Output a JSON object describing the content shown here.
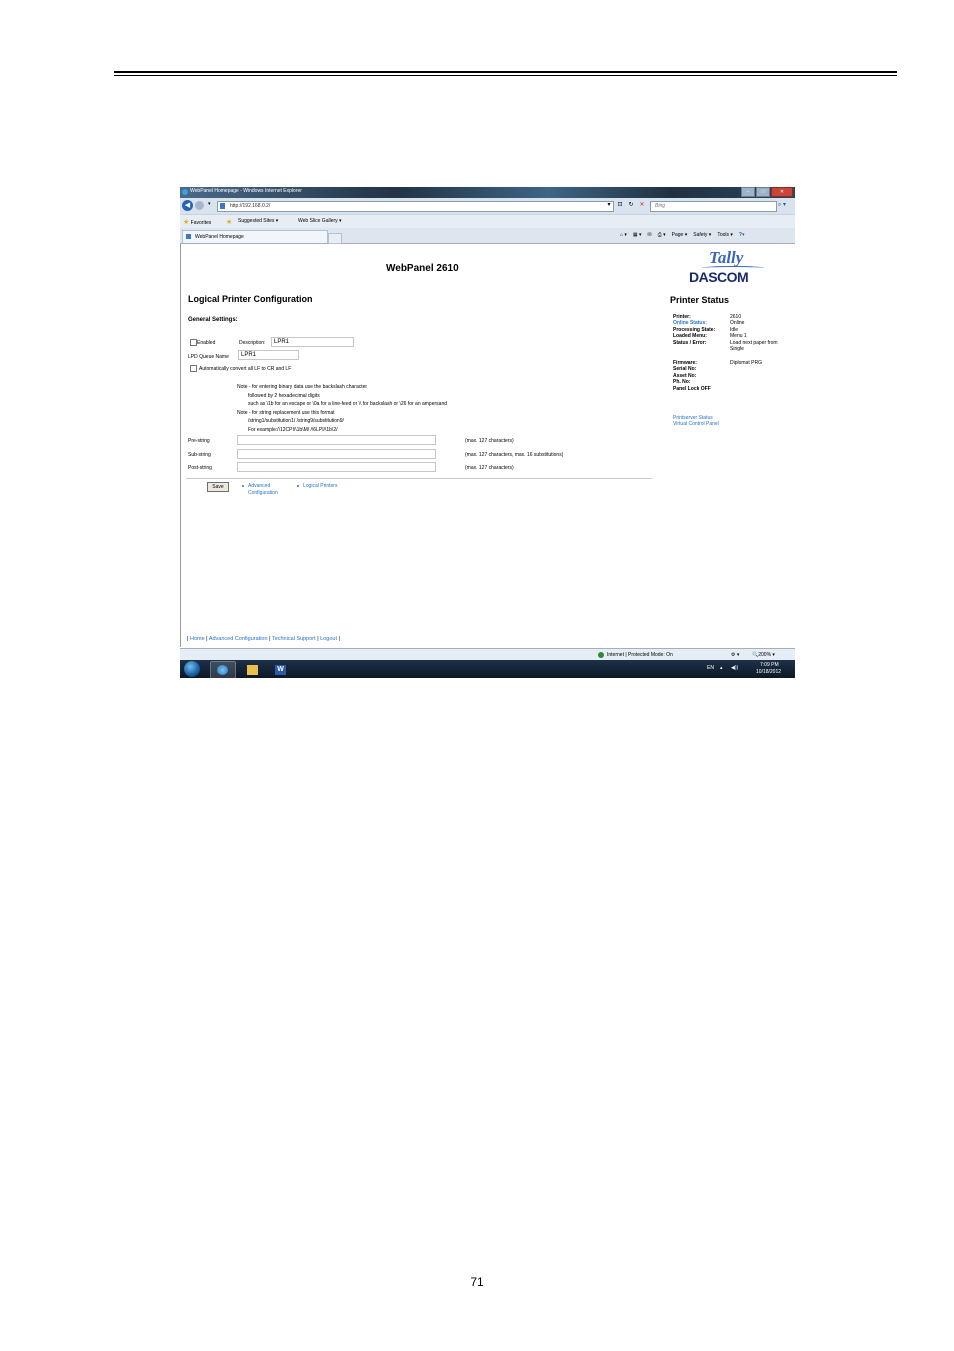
{
  "page": {
    "number": "71"
  },
  "browser": {
    "window_title": "WebPanel Homepage - Windows Internet Explorer",
    "address": "http://192.168.0.2/",
    "search_placeholder": "Bing",
    "favorites": {
      "favorites_label": "Favorites",
      "suggested_sites": "Suggested Sites ▾",
      "web_slice_gallery": "Web Slice Gallery ▾"
    },
    "tab_label": "WebPanel Homepage",
    "command_bar": {
      "page": "Page ▾",
      "safety": "Safety ▾",
      "tools": "Tools ▾",
      "help": "?▾"
    },
    "status": {
      "zone": "Internet | Protected Mode: On",
      "zoom": "200%"
    }
  },
  "webpanel": {
    "title": "WebPanel 2610",
    "logo": {
      "line1": "Tally",
      "line2": "DASCOM"
    },
    "section_title": "Logical Printer Configuration",
    "general_settings": "General Settings:",
    "enabled_label": "Enabled",
    "enabled_checked": false,
    "description_label": "Description:",
    "description_value": "LPR1",
    "lpd_queue_label": "LPD Queue Name",
    "lpd_queue_value": "LPR1",
    "auto_convert_label": "Automatically convert all LF to CR and LF",
    "auto_convert_checked": false,
    "notes": [
      "Note - for entering binary data use the backslash character",
      "followed by 2 hexadecimal digits",
      "such as \\1b for an escape or \\0a for a line-feed or \\\\ for backslash or \\26 for an ampersand",
      "Note - for string replacement use this format",
      "/string1/substitution1/ /string9/substitution9/",
      "For example:/\\12CPI/\\1b\\M/ /\\6LPI/\\1b\\2/"
    ],
    "fields": [
      {
        "label": "Pre-string",
        "value": "",
        "hint": "(max. 127 characters)"
      },
      {
        "label": "Sub-string",
        "value": "",
        "hint": "(max. 127 characters, max. 16 substitutions)"
      },
      {
        "label": "Post-string",
        "value": "",
        "hint": "(max. 127 characters)"
      }
    ],
    "save_label": "Save",
    "links": {
      "advanced_line1": "Advanced",
      "advanced_line2": "Configuration",
      "logical_printers": "Logical Printers"
    },
    "footer": {
      "sep1": "| ",
      "home": "Home",
      "sep2": " | ",
      "advanced": "Advanced Configuration",
      "sep3": " | ",
      "support": "Technical Support",
      "sep4": " | ",
      "logout": "Logout",
      "sep5": " |"
    }
  },
  "printer_status": {
    "title": "Printer Status",
    "rows": [
      {
        "label": "Printer:",
        "value": "2610"
      },
      {
        "label": "Online Status:",
        "value": "Online"
      },
      {
        "label": "Processing State:",
        "value": "Idle"
      },
      {
        "label": "Loaded Menu:",
        "value": "Menu 1"
      },
      {
        "label": "Status / Error:",
        "value": "Load next paper from"
      },
      {
        "label": "",
        "value": "Single"
      }
    ],
    "rows2": [
      {
        "label": "Firmware:",
        "value": "Diplomat PRG"
      },
      {
        "label": "Serial No:",
        "value": ""
      },
      {
        "label": "Asset No:",
        "value": ""
      },
      {
        "label": "Ph. No:",
        "value": ""
      },
      {
        "label": "Panel Lock OFF",
        "value": ""
      }
    ],
    "links": {
      "printserver_status": "Printserver Status",
      "virtual_control_panel": "Virtual Control Panel"
    }
  },
  "taskbar": {
    "lang": "EN",
    "time": "7:09 PM",
    "date": "10/18/2012"
  }
}
